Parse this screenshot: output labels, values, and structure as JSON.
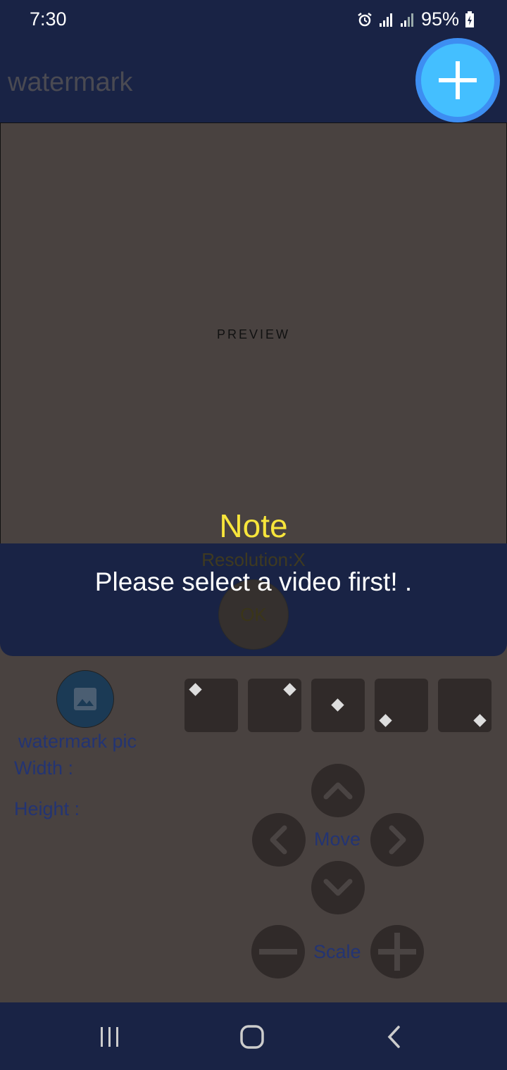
{
  "status_bar": {
    "time": "7:30",
    "battery": "95%"
  },
  "app": {
    "title": "watermark"
  },
  "preview": {
    "label": "PREVIEW"
  },
  "dialog": {
    "title": "Note",
    "message": "Please select a video first! .",
    "ok_label": "OK"
  },
  "info": {
    "resolution_label": "Resolution:X"
  },
  "controls": {
    "watermark_pic_label": "watermark pic",
    "width_label": "Width :",
    "height_label": "Height :",
    "move_label": "Move",
    "scale_label": "Scale"
  },
  "icons": {
    "fab": "plus-icon",
    "watermark_pic": "image-icon",
    "nav": [
      "recent-apps-icon",
      "home-icon",
      "back-icon"
    ]
  },
  "colors": {
    "bar": "#192345",
    "fab": "#44bfff",
    "note_title": "#f7e53b",
    "label_text": "#233473",
    "background": "#494240"
  }
}
